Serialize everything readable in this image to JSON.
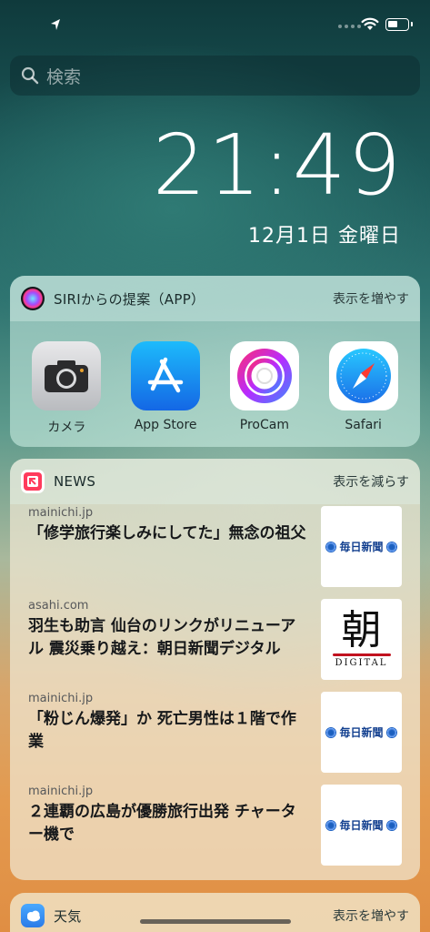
{
  "status_bar": {
    "location_icon": "location-arrow-icon",
    "wifi_icon": "wifi-icon",
    "battery_icon": "battery-icon"
  },
  "search": {
    "placeholder": "検索"
  },
  "lockscreen": {
    "time": "21:49",
    "date": "12月1日 金曜日"
  },
  "siri_widget": {
    "title": "SIRIからの提案（APP）",
    "more_label": "表示を増やす",
    "apps": [
      {
        "label": "カメラ",
        "icon": "camera-icon"
      },
      {
        "label": "App Store",
        "icon": "app-store-icon"
      },
      {
        "label": "ProCam",
        "icon": "procam-icon"
      },
      {
        "label": "Safari",
        "icon": "safari-icon"
      }
    ]
  },
  "news_widget": {
    "title": "NEWS",
    "less_label": "表示を減らす",
    "items": [
      {
        "source": "mainichi.jp",
        "headline": "「修学旅行楽しみにしてた」無念の祖父",
        "thumb": "毎日新聞"
      },
      {
        "source": "asahi.com",
        "headline": "羽生も助言 仙台のリンクがリニューアル 震災乗り越え：朝日新聞デジタル",
        "thumb_kanji": "朝",
        "thumb_text": "DIGITAL"
      },
      {
        "source": "mainichi.jp",
        "headline": "「粉じん爆発」か 死亡男性は１階で作業",
        "thumb": "毎日新聞"
      },
      {
        "source": "mainichi.jp",
        "headline": "２連覇の広島が優勝旅行出発 チャーター機で",
        "thumb": "毎日新聞"
      }
    ]
  },
  "weather_widget": {
    "title": "天気",
    "more_label": "表示を増やす"
  }
}
